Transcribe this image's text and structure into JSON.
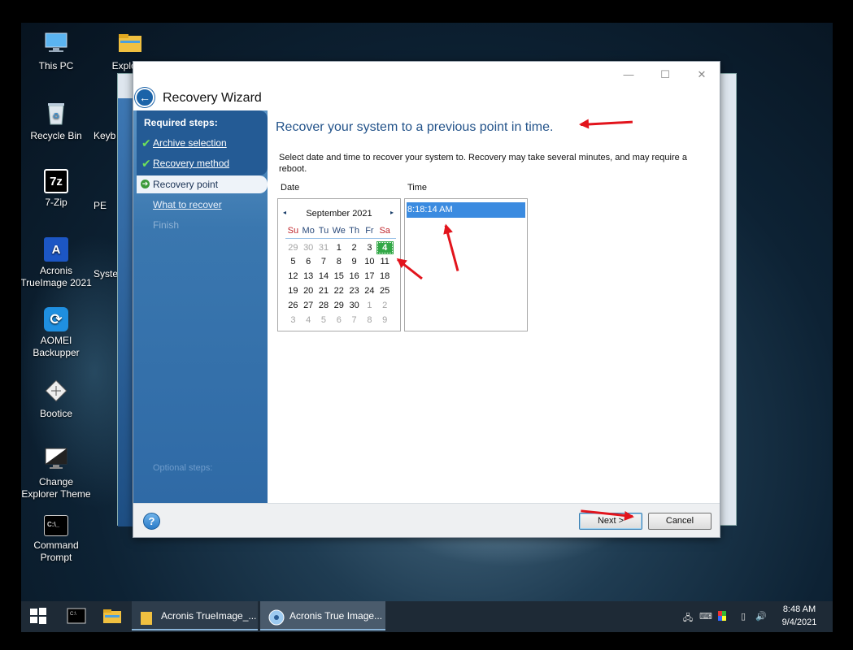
{
  "desktop": {
    "icons": [
      {
        "label": "This PC",
        "icon": "this-pc-icon"
      },
      {
        "label": "Explorer",
        "icon": "explorer-icon"
      },
      {
        "label": "Recycle Bin",
        "icon": "recycle-bin-icon"
      },
      {
        "label": "Keyb",
        "icon": "keyboard-icon"
      },
      {
        "label": "7-Zip",
        "icon": "7zip-icon",
        "glyph": "7z"
      },
      {
        "label": "PE",
        "icon": "pe-icon"
      },
      {
        "label": "Acronis TrueImage 2021",
        "icon": "acronis-icon",
        "glyph": "A"
      },
      {
        "label": "Syste",
        "icon": "system-icon"
      },
      {
        "label": "AOMEI Backupper",
        "icon": "aomei-icon"
      },
      {
        "label": "Bootice",
        "icon": "bootice-icon"
      },
      {
        "label": "Change Explorer Theme",
        "icon": "monitor-icon"
      },
      {
        "label": "Command Prompt",
        "icon": "cmd-icon",
        "glyph": "C:\\_"
      }
    ]
  },
  "wizard": {
    "title": "Recovery Wizard",
    "sidebar": {
      "required_heading": "Required steps:",
      "archive_selection": "Archive selection",
      "recovery_method": "Recovery method",
      "recovery_point": "Recovery point",
      "what_to_recover": "What to recover",
      "finish": "Finish",
      "optional_heading": "Optional steps:"
    },
    "content": {
      "heading": "Recover your system to a previous point in time.",
      "description": "Select date and time to recover your system to. Recovery may take several minutes, and may require a reboot.",
      "date_label": "Date",
      "time_label": "Time"
    },
    "calendar": {
      "month_label": "September 2021",
      "prev_glyph": "◂",
      "next_glyph": "▸",
      "weekdays": [
        "Su",
        "Mo",
        "Tu",
        "We",
        "Th",
        "Fr",
        "Sa"
      ],
      "weeks": [
        [
          "29",
          "30",
          "31",
          "1",
          "2",
          "3",
          "4"
        ],
        [
          "5",
          "6",
          "7",
          "8",
          "9",
          "10",
          "11"
        ],
        [
          "12",
          "13",
          "14",
          "15",
          "16",
          "17",
          "18"
        ],
        [
          "19",
          "20",
          "21",
          "22",
          "23",
          "24",
          "25"
        ],
        [
          "26",
          "27",
          "28",
          "29",
          "30",
          "1",
          "2"
        ],
        [
          "3",
          "4",
          "5",
          "6",
          "7",
          "8",
          "9"
        ]
      ],
      "selected": "4"
    },
    "time": {
      "items": [
        "8:18:14 AM"
      ]
    },
    "footer": {
      "help_glyph": "?",
      "next_label": "Next >",
      "cancel_label": "Cancel"
    }
  },
  "taskbar": {
    "tasks": [
      "Acronis TrueImage_...",
      "Acronis True Image..."
    ],
    "time": "8:48 AM",
    "date": "9/4/2021"
  },
  "colors": {
    "accent": "#23538a",
    "sidebar": "#3a77af",
    "selected_day": "#31a846",
    "selected_time": "#3b8be0",
    "annotation_arrow": "#e2141c"
  }
}
